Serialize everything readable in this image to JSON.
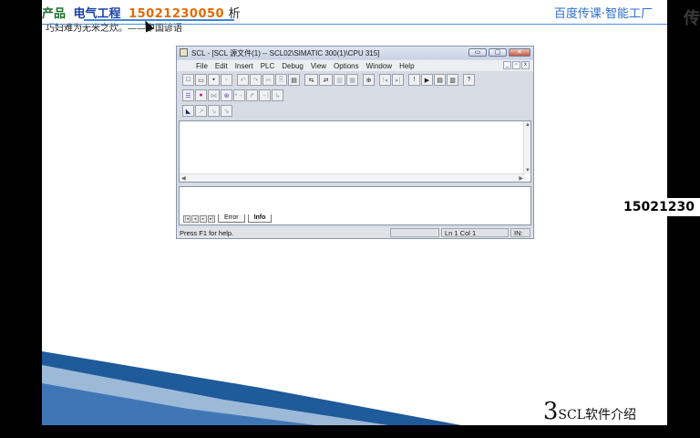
{
  "slide": {
    "banner_a": "产品",
    "banner_b": "电气工程",
    "banner_c": "15021230050",
    "banner_d": "析",
    "proverb": "巧妇难为无米之炊。——中国谚语",
    "brand": "百度传课·智能工厂",
    "topic_number": "3",
    "topic_text": "SCL软件介绍"
  },
  "side": {
    "corner_char": "传",
    "phone": "15021230"
  },
  "window": {
    "title": "SCL - [SCL 源文件(1) -- SCL02\\SIMATIC 300(1)\\CPU 315]",
    "controls": [
      "▭",
      "▢",
      "✕"
    ],
    "menu": [
      "File",
      "Edit",
      "Insert",
      "PLC",
      "Debug",
      "View",
      "Options",
      "Window",
      "Help"
    ],
    "doc_controls": [
      "_",
      "▫",
      "x"
    ],
    "toolbar1": [
      "□",
      "▭",
      "▪",
      "▫",
      "↶",
      "↷",
      "✂",
      "⎘",
      "▤",
      "⇆",
      "⇄",
      "▥",
      "▦",
      "⊕",
      "!◂",
      "▸|",
      "!",
      "▶",
      "▤",
      "▥",
      "?"
    ],
    "toolbar2": [
      "☰",
      "●",
      "⋈",
      "⊛",
      "•→",
      "↱",
      "→|",
      "↳"
    ],
    "toolbar3": [
      "◣",
      "↗",
      "↘",
      "⇘"
    ],
    "output_tabs": [
      "Error",
      "Info"
    ],
    "nav_arrows": [
      "|◂",
      "◂",
      "▸",
      "▸|"
    ],
    "status": {
      "help": "Press F1 for help.",
      "position": "Ln 1 Col 1",
      "mode": "IN:"
    }
  },
  "colors": {
    "accent_blue": "#2f6fd0",
    "phone_orange": "#e56a00",
    "deco_blue": "#1f5a9a"
  }
}
